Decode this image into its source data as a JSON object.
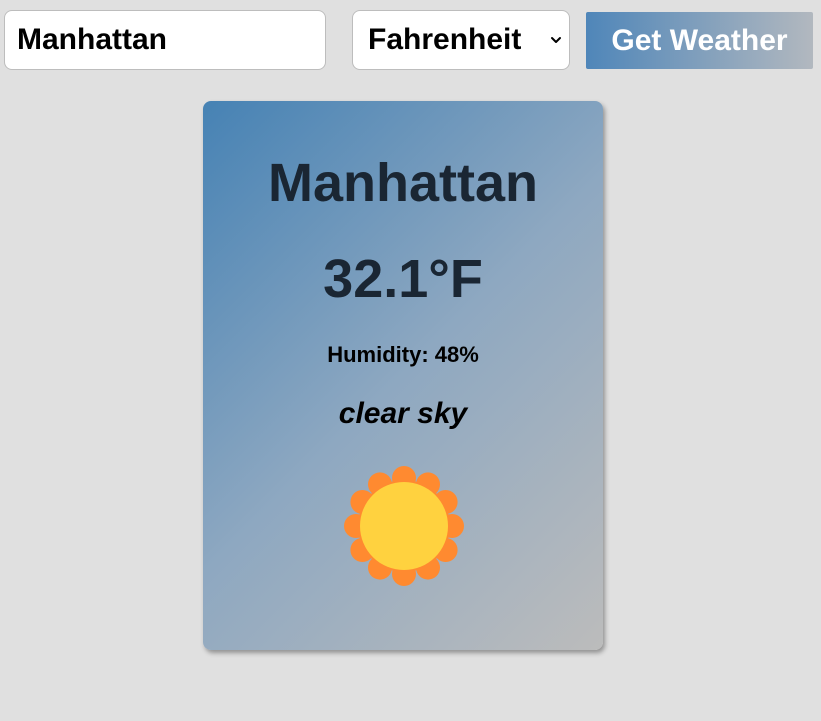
{
  "form": {
    "city_value": "Manhattan",
    "unit_selected": "Fahrenheit",
    "submit_label": "Get Weather"
  },
  "weather": {
    "city": "Manhattan",
    "temperature": "32.1°F",
    "humidity": "Humidity: 48%",
    "description": "clear sky",
    "icon": "sun-icon"
  },
  "colors": {
    "page_background": "#e0e0e0",
    "card_gradient_start": "#4682b4",
    "card_gradient_end": "#bcbcbc",
    "heading_text": "#1a2633",
    "sun_rays": "#ff8a30",
    "sun_core": "#ffd23f"
  }
}
